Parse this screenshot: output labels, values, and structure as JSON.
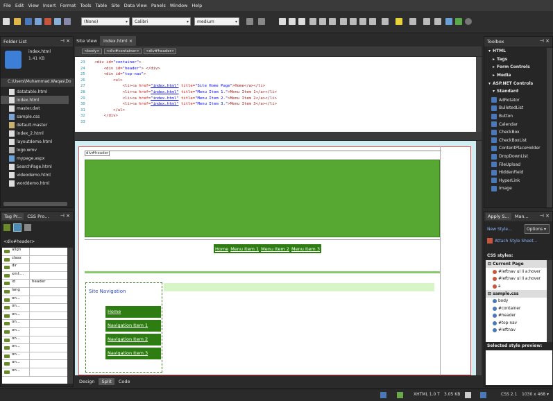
{
  "menu": [
    "File",
    "Edit",
    "View",
    "Insert",
    "Format",
    "Tools",
    "Table",
    "Site",
    "Data View",
    "Panels",
    "Window",
    "Help"
  ],
  "toolbar": {
    "style_select": "(None)",
    "font_select": "Calibri",
    "size_select": "medium"
  },
  "folder_list": {
    "title": "Folder List",
    "preview_name": "index.html",
    "preview_size": "1.41 KB",
    "path": "C:\\Users\\Muhammad.Waqas\\Do",
    "files": [
      "datatable.html",
      "index.html",
      "master.dwt",
      "sample.css",
      "default.master",
      "index_2.html",
      "layoutdemo.html",
      "logo.wmv",
      "mypage.aspx",
      "SearchPage.html",
      "videodemo.html",
      "worddemo.html"
    ],
    "selected_index": 1
  },
  "tabs": {
    "site_view": "Site View",
    "index": "index.html",
    "close": "×"
  },
  "breadcrumb": [
    "<body>",
    "<div#container>",
    "<div#header>"
  ],
  "code": {
    "lines": [
      {
        "n": "23",
        "indent": "    ",
        "text": [
          [
            "tag",
            "<div "
          ],
          [
            "attr",
            "id"
          ],
          [
            "tag",
            "="
          ],
          [
            "strn",
            "\"container\""
          ],
          [
            "tag",
            ">"
          ]
        ]
      },
      {
        "n": "24",
        "indent": "        ",
        "text": [
          [
            "tag",
            "<div "
          ],
          [
            "attr",
            "id"
          ],
          [
            "tag",
            "="
          ],
          [
            "strn",
            "\"header\""
          ],
          [
            "tag",
            "> "
          ],
          [
            "tag",
            "</div>"
          ]
        ]
      },
      {
        "n": "25",
        "indent": "        ",
        "text": [
          [
            "tag",
            "<div "
          ],
          [
            "attr",
            "id"
          ],
          [
            "tag",
            "="
          ],
          [
            "strn",
            "\"top-nav\""
          ],
          [
            "tag",
            ">"
          ]
        ]
      },
      {
        "n": "26",
        "indent": "            ",
        "text": [
          [
            "tag",
            "<ul>"
          ]
        ]
      },
      {
        "n": "27",
        "indent": "                ",
        "text": [
          [
            "tag",
            "<li><a "
          ],
          [
            "attr",
            "href"
          ],
          [
            "tag",
            "="
          ],
          [
            "str",
            "\"index.html\""
          ],
          [
            "attr",
            " title"
          ],
          [
            "tag",
            "="
          ],
          [
            "strn",
            "\"Site Home Page\""
          ],
          [
            "tag",
            ">Home</a></li>"
          ]
        ]
      },
      {
        "n": "28",
        "indent": "                ",
        "text": [
          [
            "tag",
            "<li><a "
          ],
          [
            "attr",
            "href"
          ],
          [
            "tag",
            "="
          ],
          [
            "str",
            "\"index.html\""
          ],
          [
            "attr",
            " title"
          ],
          [
            "tag",
            "="
          ],
          [
            "strn",
            "\"Menu Item 1.\""
          ],
          [
            "tag",
            ">Menu Item 1</a></li>"
          ]
        ]
      },
      {
        "n": "29",
        "indent": "                ",
        "text": [
          [
            "tag",
            "<li><a "
          ],
          [
            "attr",
            "href"
          ],
          [
            "tag",
            "="
          ],
          [
            "str",
            "\"index.html\""
          ],
          [
            "attr",
            " title"
          ],
          [
            "tag",
            "="
          ],
          [
            "strn",
            "\"Menu Item 2.\""
          ],
          [
            "tag",
            ">Menu Item 2</a></li>"
          ]
        ]
      },
      {
        "n": "30",
        "indent": "                ",
        "text": [
          [
            "tag",
            "<li><a "
          ],
          [
            "attr",
            "href"
          ],
          [
            "tag",
            "="
          ],
          [
            "str",
            "\"index.html\""
          ],
          [
            "attr",
            " title"
          ],
          [
            "tag",
            "="
          ],
          [
            "strn",
            "\"Menu Item 3.\""
          ],
          [
            "tag",
            ">Menu Item 3</a></li>"
          ]
        ]
      },
      {
        "n": "31",
        "indent": "            ",
        "text": [
          [
            "tag",
            "</ul>"
          ]
        ]
      },
      {
        "n": "32",
        "indent": "        ",
        "text": [
          [
            "tag",
            "</div>"
          ]
        ]
      },
      {
        "n": "33",
        "indent": "",
        "text": []
      }
    ]
  },
  "design": {
    "header_tag": "div#header",
    "top_nav": [
      "Home",
      "Menu Item 1",
      "Menu Item 2",
      "Menu Item 3"
    ],
    "site_nav_title": "Site Navigation",
    "nav_items": [
      "Home",
      "Navigation Item 1",
      "Navigation Item 2",
      "Navigation Item 3"
    ]
  },
  "view_tabs": [
    "Design",
    "Split",
    "Code"
  ],
  "tag_props": {
    "tab1": "Tag Pr...",
    "tab2": "CSS Pro...",
    "current": "<div#header>",
    "rows": [
      {
        "k": "align",
        "v": ""
      },
      {
        "k": "class",
        "v": ""
      },
      {
        "k": "dir",
        "v": ""
      },
      {
        "k": "xml:...",
        "v": ""
      },
      {
        "k": "id",
        "v": "header"
      },
      {
        "k": "lang",
        "v": ""
      },
      {
        "k": "on...",
        "v": ""
      },
      {
        "k": "on...",
        "v": ""
      },
      {
        "k": "on...",
        "v": ""
      },
      {
        "k": "on...",
        "v": ""
      },
      {
        "k": "on...",
        "v": ""
      },
      {
        "k": "on...",
        "v": ""
      },
      {
        "k": "on...",
        "v": ""
      },
      {
        "k": "on...",
        "v": ""
      },
      {
        "k": "on...",
        "v": ""
      },
      {
        "k": "on...",
        "v": ""
      }
    ]
  },
  "toolbox": {
    "title": "Toolbox",
    "groups": [
      {
        "label": "HTML",
        "level": 0
      },
      {
        "label": "Tags",
        "level": 1
      },
      {
        "label": "Form Controls",
        "level": 1
      },
      {
        "label": "Media",
        "level": 1
      },
      {
        "label": "ASP.NET Controls",
        "level": 0
      },
      {
        "label": "Standard",
        "level": 1
      }
    ],
    "items": [
      "AdRotator",
      "BulletedList",
      "Button",
      "Calendar",
      "CheckBox",
      "CheckBoxList",
      "ContentPlaceHolder",
      "DropDownList",
      "FileUpload",
      "HiddenField",
      "HyperLink",
      "Image"
    ]
  },
  "apply_styles": {
    "tab1": "Apply S...",
    "tab2": "Man...",
    "new_style": "New Style...",
    "options": "Options ▾",
    "attach": "Attach Style Sheet...",
    "css_styles": "CSS styles:",
    "current_page": "Current Page",
    "current_rules": [
      "#leftnav ul li a:hover",
      "#leftnav ul li a:hover",
      "a"
    ],
    "sample_css": "sample.css",
    "sample_rules": [
      "body",
      "#container",
      "#header",
      "#top-nav",
      "#leftnav"
    ],
    "preview": "Selected style preview:"
  },
  "status": {
    "doctype": "XHTML 1.0 T",
    "size": "3.05 KB",
    "css": "CSS 2.1",
    "dims": "1030 x 468 ▾"
  }
}
